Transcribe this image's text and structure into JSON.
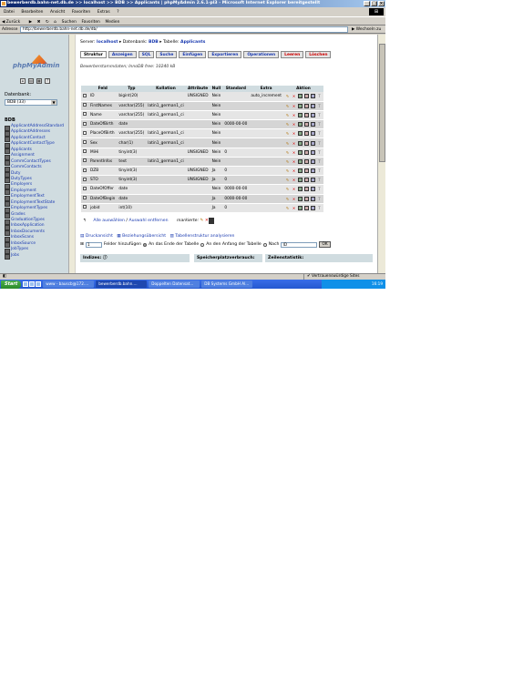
{
  "window": {
    "title": "bewerberdb.bahn-net.db.de >> localhost >> BDB >> Applicants | phpMyAdmin 2.6.1-pl3 - Microsoft Internet Explorer bereitgestellt"
  },
  "menu": [
    "Datei",
    "Bearbeiten",
    "Ansicht",
    "Favoriten",
    "Extras",
    "?"
  ],
  "toolbar": [
    "Zurück",
    "Suchen",
    "Favoriten",
    "Medien"
  ],
  "address": {
    "label": "Adresse",
    "url": "http://bewerberdb.bahn-net.db.de/db/",
    "go": "Wechseln zu"
  },
  "left": {
    "logo": "phpMyAdmin",
    "db_label": "Datenbank:",
    "db_select": "BDB (33)",
    "db_name": "BDB",
    "tables": [
      "ApplicantAddressStandard",
      "ApplicantAddresses",
      "ApplicantContact",
      "ApplicantContactType",
      "Applicants",
      "Assignment",
      "CommContactTypes",
      "CommContacts",
      "Duty",
      "DutyTypes",
      "Employers",
      "Employment",
      "EmploymentText",
      "EmploymentTextState",
      "EmploymentTypes",
      "Grades",
      "GraduationTypes",
      "InboxApplication",
      "InboxDocuments",
      "InboxScans",
      "InboxSource",
      "JobTypes",
      "Jobs"
    ]
  },
  "crumbs": {
    "server_label": "Server:",
    "server": "localhost",
    "db_label": "Datenbank:",
    "db": "BDB",
    "table_label": "Tabelle:",
    "table": "Applicants"
  },
  "tabs": [
    "Struktur",
    "Anzeigen",
    "SQL",
    "Suche",
    "Einfügen",
    "Exportieren",
    "Operationen",
    "Leeren",
    "Löschen"
  ],
  "storage": "Bewerberstammdaten; InnoDB free: 10240 kB",
  "columns": [
    "Feld",
    "Typ",
    "Kollation",
    "Attribute",
    "Null",
    "Standard",
    "Extra",
    "Aktion"
  ],
  "rows": [
    [
      "ID",
      "bigint(20)",
      "",
      "UNSIGNED",
      "Nein",
      "",
      "auto_increment"
    ],
    [
      "FirstNames",
      "varchar(255)",
      "latin1_german1_ci",
      "",
      "Nein",
      "",
      ""
    ],
    [
      "Name",
      "varchar(255)",
      "latin1_german1_ci",
      "",
      "Nein",
      "",
      ""
    ],
    [
      "DateOfBirth",
      "date",
      "",
      "",
      "Nein",
      "0000-00-00",
      ""
    ],
    [
      "PlaceOfBirth",
      "varchar(255)",
      "latin1_german1_ci",
      "",
      "Nein",
      "",
      ""
    ],
    [
      "Sex",
      "char(1)",
      "latin1_german1_ci",
      "",
      "Nein",
      "",
      ""
    ],
    [
      "MiHi",
      "tinyint(3)",
      "",
      "UNSIGNED",
      "Nein",
      "0",
      ""
    ],
    [
      "ParentInfos",
      "text",
      "latin1_german1_ci",
      "",
      "Nein",
      "",
      ""
    ],
    [
      "DZB",
      "tinyint(3)",
      "",
      "UNSIGNED",
      "Ja",
      "0",
      ""
    ],
    [
      "STO",
      "tinyint(3)",
      "",
      "UNSIGNED",
      "Ja",
      "0",
      ""
    ],
    [
      "DateOfOffer",
      "date",
      "",
      "",
      "Nein",
      "0000-00-00",
      ""
    ],
    [
      "DateOfBegin",
      "date",
      "",
      "",
      "Ja",
      "0000-00-00",
      ""
    ],
    [
      "jobid",
      "int(10)",
      "",
      "",
      "Ja",
      "0",
      ""
    ]
  ],
  "below": {
    "select_all": "Alle auswählen",
    "sep": "/",
    "deselect_all": "Auswahl entfernen",
    "marked": "markierte:"
  },
  "links": [
    "Druckansicht",
    "Beziehungsübersicht",
    "Tabellenstruktur analysieren"
  ],
  "addfield": {
    "count": "1",
    "label": "Felder hinzufügen",
    "opt_end": "An das Ende der Tabelle",
    "opt_begin": "An den Anfang der Tabelle",
    "opt_after": "Nach",
    "after_field": "ID",
    "ok": "OK"
  },
  "sections": {
    "indexes": "Indizes:",
    "space": "Speicherplatzverbrauch:",
    "rowstats": "Zeilenstatistik:"
  },
  "status": {
    "zone": "Vertrauenswürdige Sites"
  },
  "taskbar": {
    "start": "Start",
    "items": [
      "www - bauscb@172....",
      "bewerberdb.bahn....",
      "Doppelten Datensat...",
      "DB Systems GmbH Al..."
    ],
    "time": "16:19"
  }
}
